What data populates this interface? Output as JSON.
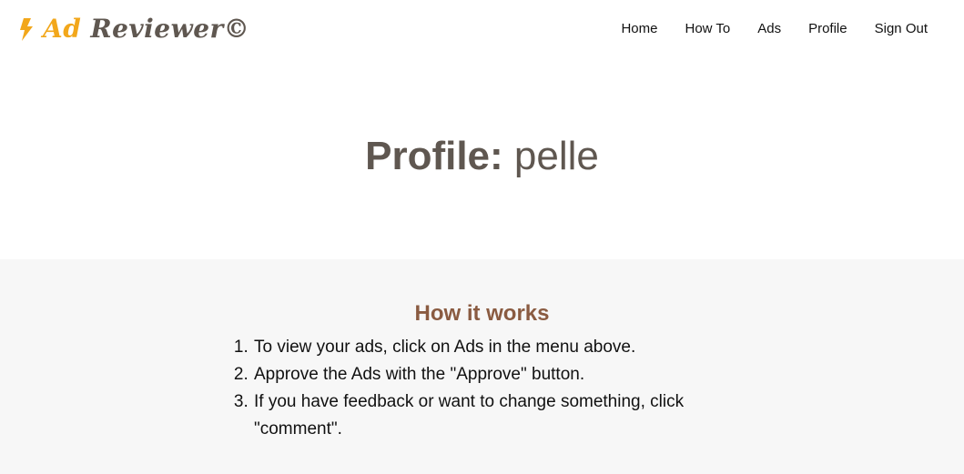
{
  "header": {
    "logo_ad": "Ad",
    "logo_reviewer": "Reviewer©",
    "nav": [
      "Home",
      "How To",
      "Ads",
      "Profile",
      "Sign Out"
    ]
  },
  "hero": {
    "label": "Profile:",
    "username": "pelle"
  },
  "how_it_works": {
    "title": "How it works",
    "steps": [
      "To view your ads, click on Ads in the menu above.",
      "Approve the Ads with the \"Approve\" button.",
      "If you have feedback or want to change something, click \"comment\"."
    ]
  },
  "colors": {
    "accent": "#f2a71b",
    "brand_dark": "#5f5750",
    "heading_brown": "#8a5b41",
    "section_bg": "#f7f7f7"
  }
}
